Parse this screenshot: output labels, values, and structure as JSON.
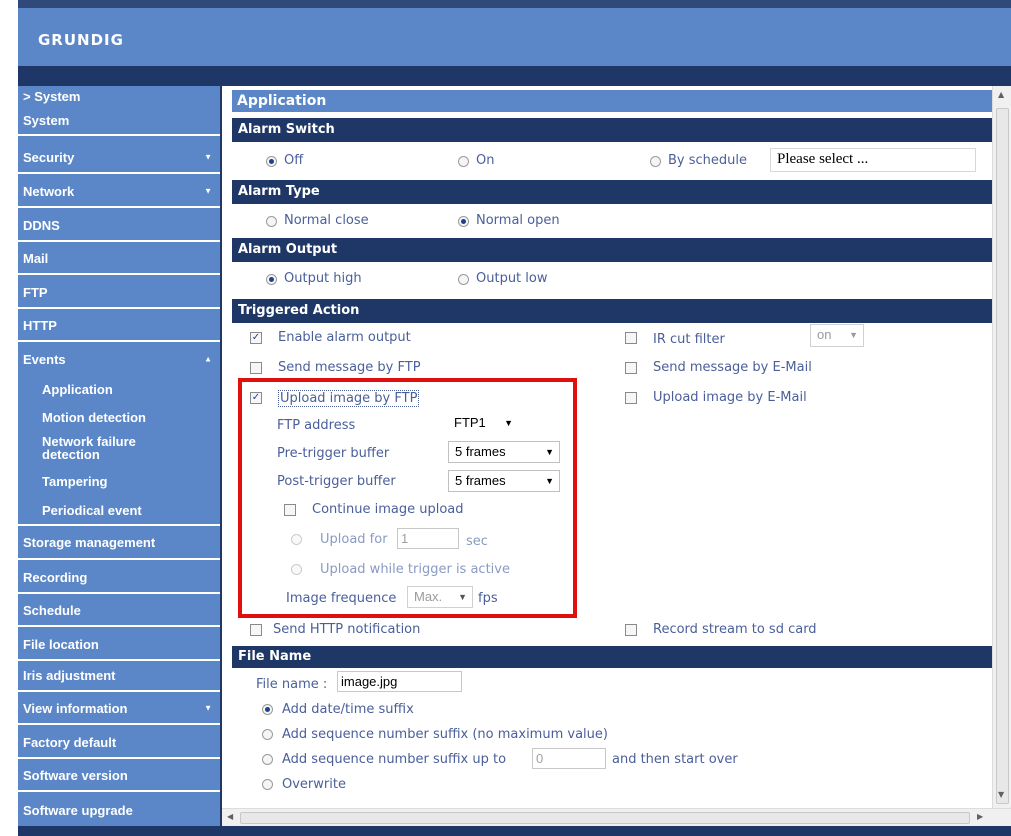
{
  "brand": {
    "logo": "GRUNDIG"
  },
  "sidebar": {
    "section_header": "> System",
    "items": [
      {
        "label": "System"
      },
      {
        "label": "Security",
        "arrow": "▼"
      },
      {
        "label": "Network",
        "arrow": "▼"
      },
      {
        "label": "DDNS"
      },
      {
        "label": "Mail"
      },
      {
        "label": "FTP"
      },
      {
        "label": "HTTP"
      },
      {
        "label": "Events",
        "arrow": "▲"
      },
      {
        "label": "Storage management"
      },
      {
        "label": "Recording"
      },
      {
        "label": "Schedule"
      },
      {
        "label": "File location"
      },
      {
        "label": "Iris adjustment"
      },
      {
        "label": "View information",
        "arrow": "▼"
      },
      {
        "label": "Factory default"
      },
      {
        "label": "Software version"
      },
      {
        "label": "Software upgrade"
      }
    ],
    "events_sub": [
      "Application",
      "Motion detection",
      "Network failure detection",
      "Tampering",
      "Periodical event"
    ]
  },
  "page": {
    "title": "Application",
    "alarm_switch": {
      "header": "Alarm Switch",
      "off": "Off",
      "on": "On",
      "by_schedule": "By schedule",
      "schedule_select": "Please select ...",
      "selected": "Off"
    },
    "alarm_type": {
      "header": "Alarm Type",
      "normal_close": "Normal close",
      "normal_open": "Normal open",
      "selected": "Normal open"
    },
    "alarm_output": {
      "header": "Alarm Output",
      "output_high": "Output high",
      "output_low": "Output low",
      "selected": "Output high"
    },
    "triggered_action": {
      "header": "Triggered Action",
      "enable_alarm_output": "Enable alarm output",
      "ir_cut_filter": "IR cut filter",
      "ir_cut_value": "on",
      "send_message_ftp": "Send message by FTP",
      "send_message_email": "Send message by E-Mail",
      "upload_image_ftp": "Upload image by FTP",
      "upload_image_email": "Upload image by E-Mail",
      "ftp_address_label": "FTP address",
      "ftp_address_value": "FTP1",
      "pre_trigger_label": "Pre-trigger buffer",
      "pre_trigger_value": "5 frames",
      "post_trigger_label": "Post-trigger buffer",
      "post_trigger_value": "5 frames",
      "continue_upload": "Continue image upload",
      "upload_for": "Upload for",
      "upload_for_value": "1",
      "sec": "sec",
      "upload_while": "Upload while trigger is active",
      "image_frequence": "Image frequence",
      "image_frequence_value": "Max.",
      "fps": "fps",
      "send_http": "Send HTTP notification",
      "record_sd": "Record stream to sd card"
    },
    "file_name": {
      "header": "File Name",
      "label": "File name :",
      "value": "image.jpg",
      "opt_datetime": "Add date/time suffix",
      "opt_seq_nomax": "Add sequence number suffix (no maximum value)",
      "opt_seq_upto": "Add sequence number suffix up to",
      "seq_upto_value": "0",
      "then_start_over": "and then start over",
      "opt_overwrite": "Overwrite"
    }
  },
  "colors": {
    "navy": "#1f3766",
    "blue": "#5b87c8",
    "highlight": "#e01010"
  }
}
